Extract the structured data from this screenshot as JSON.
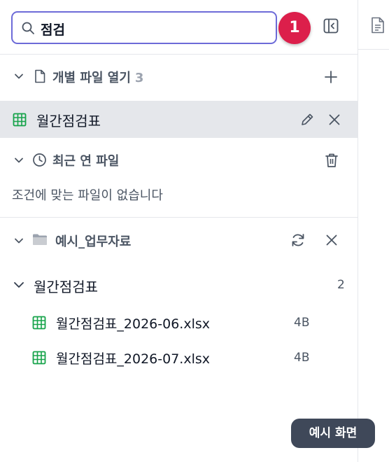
{
  "search": {
    "value": "점검"
  },
  "notification_badge": {
    "count": "1"
  },
  "open_files": {
    "title": "개별 파일 열기",
    "count": "3",
    "items": [
      {
        "name": "월간점검표"
      }
    ]
  },
  "recent_files": {
    "title": "최근 연 파일",
    "empty_text": "조건에 맞는 파일이 없습니다"
  },
  "folder": {
    "name": "예시_업무자료",
    "group": {
      "name": "월간점검표",
      "count": "2"
    },
    "files": [
      {
        "name": "월간점검표_2026-06.xlsx",
        "size": "4B"
      },
      {
        "name": "월간점검표_2026-07.xlsx",
        "size": "4B"
      }
    ]
  },
  "toast": {
    "text": "예시 화면"
  },
  "colors": {
    "accent": "#6d6bd8",
    "badge": "#dc1f4b",
    "sheet_icon": "#16a34a",
    "selected_row": "#e5e7eb",
    "toast_bg": "#3f4859"
  }
}
